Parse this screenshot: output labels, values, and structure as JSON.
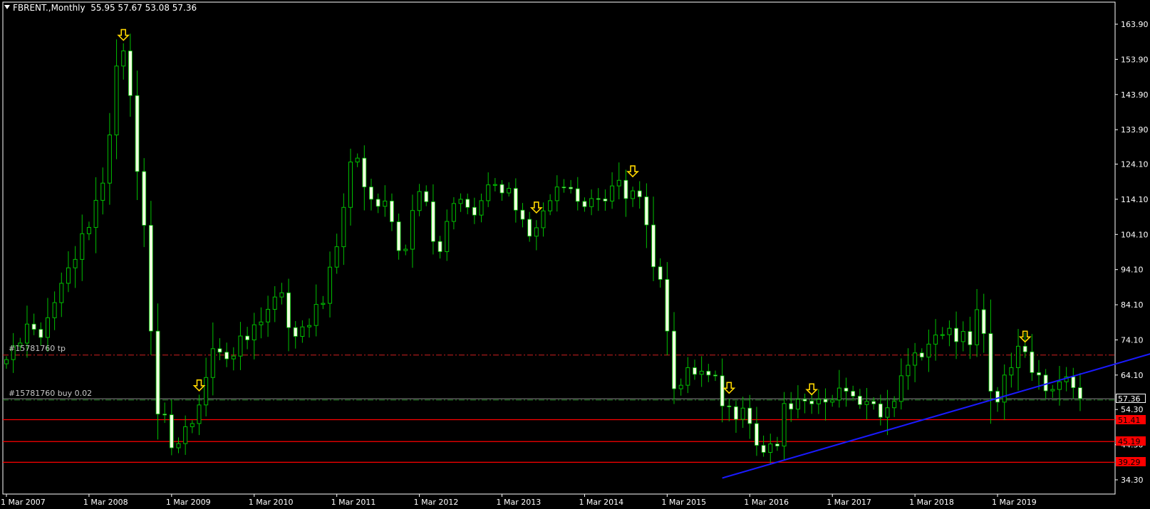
{
  "header": {
    "symbol": "FBRENT.,Monthly",
    "ohlc": "55.95 57.67 53.08 57.36"
  },
  "orders": {
    "tp_label": "#15781760 tp",
    "buy_label": "#15781760 buy 0.02"
  },
  "price_tags": {
    "current": "57.36",
    "level1": "51.41",
    "level2": "45.19",
    "level3": "39.29"
  },
  "colors": {
    "background": "#000000",
    "axis": "#ffffff",
    "bull": "#00c000",
    "bear_body": "#f0ffe0",
    "tp_line": "#d02020",
    "buy_line": "#2a8a2a",
    "support": "#ff0000",
    "trendline": "#1a1aff",
    "arrow": "#ffd700"
  },
  "chart_data": {
    "type": "candlestick",
    "timeframe": "Monthly",
    "ylim": [
      32.5,
      167
    ],
    "y_ticks": [
      163.9,
      153.9,
      143.9,
      133.9,
      124.1,
      114.1,
      104.1,
      94.1,
      84.1,
      74.1,
      64.1,
      54.3,
      44.3,
      34.3
    ],
    "y_tick_labels": [
      "163.90",
      "153.90",
      "143.90",
      "133.90",
      "124.10",
      "114.10",
      "104.10",
      "94.10",
      "84.10",
      "74.10",
      "64.10",
      "54.30",
      "44.30",
      "34.30"
    ],
    "x_tick_labels": [
      "1 Mar 2007",
      "1 Mar 2008",
      "1 Mar 2009",
      "1 Mar 2010",
      "1 Mar 2011",
      "1 Mar 2012",
      "1 Mar 2013",
      "1 Mar 2014",
      "1 Mar 2015",
      "1 Mar 2016",
      "1 Mar 2017",
      "1 Mar 2018",
      "1 Mar 2019"
    ],
    "x_tick_month_index": [
      0,
      12,
      24,
      36,
      48,
      60,
      72,
      84,
      96,
      108,
      120,
      132,
      144
    ],
    "first_bar": "2007-03",
    "last_bar": "2019-10",
    "closes": [
      68.5,
      72.4,
      73.2,
      78.6,
      77.1,
      74.8,
      80.4,
      84.7,
      90.2,
      94.6,
      97.0,
      104.3,
      106.1,
      113.8,
      118.7,
      132.4,
      152.0,
      156.3,
      143.6,
      122.0,
      106.7,
      76.6,
      53.0,
      52.8,
      43.4,
      44.6,
      49.4,
      50.3,
      55.6,
      63.4,
      71.6,
      70.6,
      68.7,
      69.5,
      75.2,
      74.1,
      78.4,
      79.2,
      82.8,
      86.3,
      87.5,
      77.6,
      75.1,
      77.8,
      78.2,
      84.2,
      84.5,
      94.8,
      100.6,
      111.8,
      124.7,
      125.8,
      117.6,
      114.1,
      112.1,
      113.6,
      107.7,
      99.5,
      99.9,
      110.9,
      116.3,
      113.4,
      102.1,
      99.2,
      107.8,
      112.9,
      114.1,
      111.8,
      109.6,
      113.7,
      118.2,
      118.3,
      115.9,
      117.2,
      111.0,
      108.4,
      103.6,
      106.0,
      110.8,
      113.7,
      117.6,
      117.5,
      117.1,
      113.5,
      112.0,
      114.3,
      114.2,
      113.6,
      117.9,
      119.5,
      114.3,
      116.5,
      114.8,
      106.8,
      94.9,
      91.3,
      76.6,
      60.2,
      61.2,
      66.2,
      64.3,
      65.2,
      64.1,
      63.9,
      55.3,
      55.1,
      51.5,
      54.7,
      50.3,
      44.1,
      42.1,
      44.5,
      43.9,
      56.0,
      54.4,
      57.2,
      56.7,
      55.9,
      57.2,
      56.4,
      57.0,
      60.4,
      59.5,
      58.1,
      55.7,
      56.6,
      55.9,
      52.1,
      54.8,
      56.6,
      63.9,
      66.9,
      70.4,
      69.2,
      72.9,
      75.5,
      75.6,
      77.4,
      73.6,
      76.5,
      72.7,
      82.7,
      75.9,
      59.5,
      56.4,
      64.1,
      66.2,
      72.3,
      70.7,
      64.8,
      64.1,
      59.6,
      60.0,
      62.2,
      63.6,
      60.5,
      57.4
    ],
    "support_levels": [
      51.41,
      45.19,
      39.29
    ],
    "order_levels": {
      "tp": 69.8,
      "buy": 57.0,
      "current": 57.36
    },
    "trendline": {
      "start": [
        "2015-11",
        34.8
      ],
      "end": [
        "2021-08",
        74.0
      ]
    },
    "arrow_markers": [
      "2008-08",
      "2009-07",
      "2013-08",
      "2014-10",
      "2015-12",
      "2016-12",
      "2019-07"
    ]
  }
}
